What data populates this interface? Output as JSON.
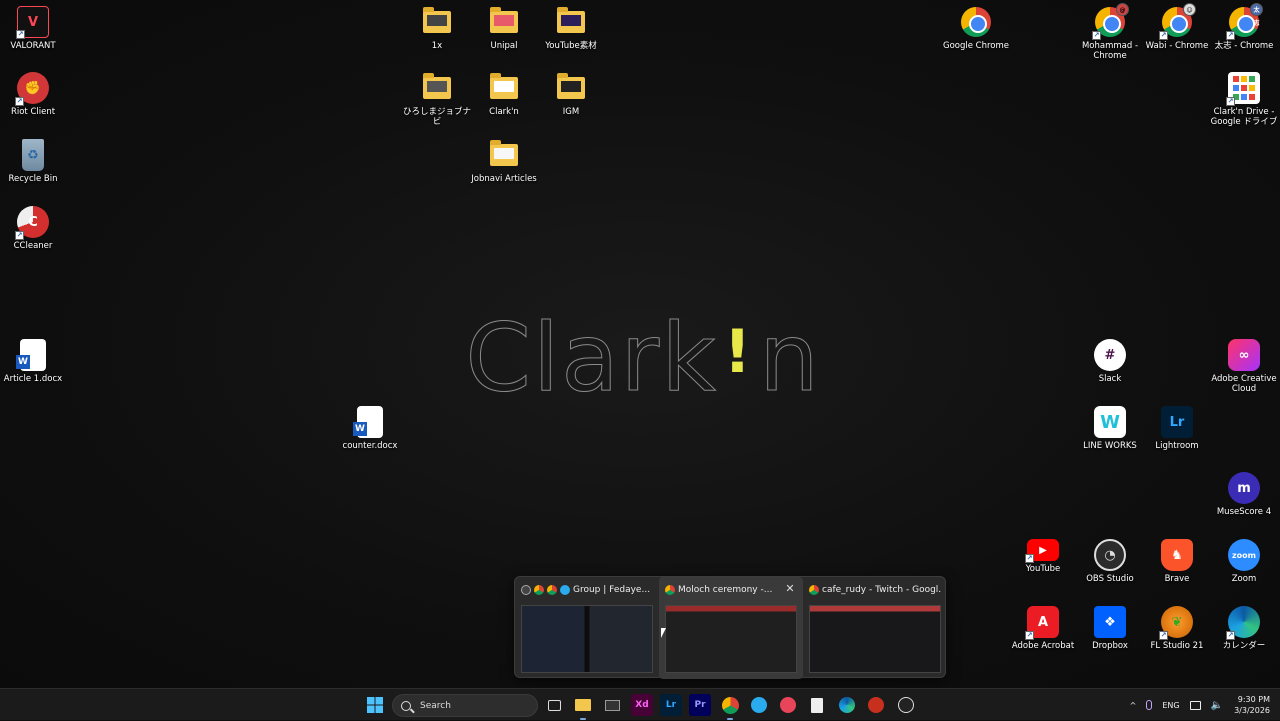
{
  "desktop": {
    "wallpaper_text": "Clark'n",
    "icons": {
      "valorant": "VALORANT",
      "riot": "Riot Client",
      "recycle": "Recycle Bin",
      "ccleaner": "CCleaner",
      "article": "Article 1.docx",
      "counter": "counter.docx",
      "f_1x": "1x",
      "f_unipal": "Unipal",
      "f_youtube": "YouTube素材",
      "f_hiroshima": "ひろしまジョブナビ",
      "f_clarkn": "Clark'n",
      "f_igm": "IGM",
      "f_jobnavi": "Jobnavi Articles",
      "chrome": "Google Chrome",
      "chrome_mohammad": "Mohammad - Chrome",
      "chrome_wabi": "Wabi - Chrome",
      "chrome_taishi": "太志 - Chrome",
      "clarkn_drive": "Clark'n Drive - Google ドライブ",
      "slack": "Slack",
      "adobe_cc": "Adobe Creative Cloud",
      "lineworks": "LINE WORKS",
      "lightroom": "Lightroom",
      "musescore": "MuseScore 4",
      "youtube": "YouTube",
      "obs": "OBS Studio",
      "brave": "Brave",
      "zoom": "Zoom",
      "acrobat": "Adobe Acrobat",
      "dropbox": "Dropbox",
      "flstudio": "FL Studio 21",
      "calendar": "カレンダー"
    },
    "badges": {
      "taishi": "太志"
    }
  },
  "preview": {
    "windows": [
      {
        "title": "Group | Fedaye..."
      },
      {
        "title": "Moloch ceremony -..."
      },
      {
        "title": "cafe_rudy - Twitch - Googl..."
      }
    ],
    "close_glyph": "✕"
  },
  "taskbar": {
    "search_placeholder": "Search",
    "apps": {
      "xd": "Xd",
      "lr": "Lr",
      "pr": "Pr"
    },
    "tray": {
      "language": "ENG",
      "time": "9:30 PM",
      "date": "3/3/2026",
      "chevron": "^"
    }
  },
  "colors": {
    "accent": "#7aa6e0",
    "folder": "#f3c64d",
    "logo_excl": "#e8e84a"
  }
}
